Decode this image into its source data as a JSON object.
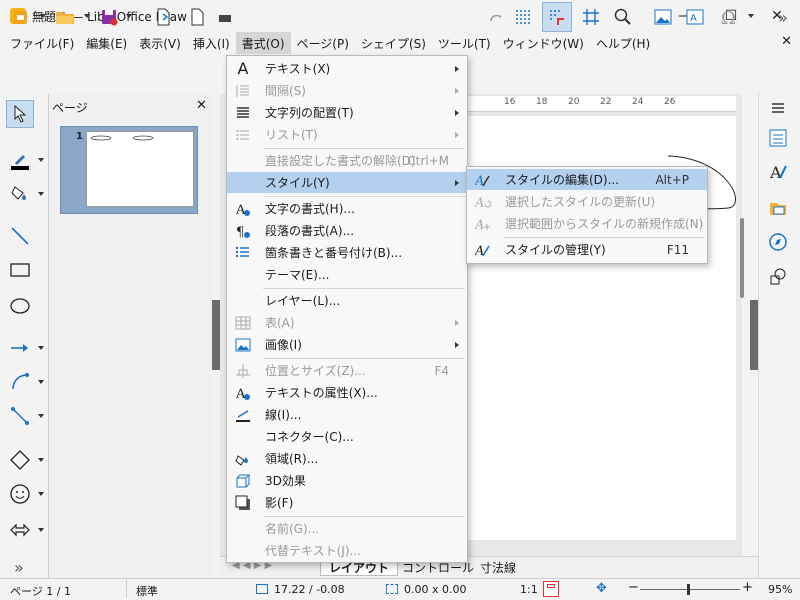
{
  "window": {
    "title": "無題 1 — LibreOffice Draw",
    "minimize": "—",
    "maximize": "☐",
    "close": "✕"
  },
  "menubar": {
    "items": [
      "ファイル(F)",
      "編集(E)",
      "表示(V)",
      "挿入(I)",
      "書式(O)",
      "ページ(P)",
      "シェイプ(S)",
      "ツール(T)",
      "ウィンドウ(W)",
      "ヘルプ(H)"
    ],
    "close": "✕"
  },
  "pages_panel": {
    "title": "ページ",
    "close": "✕",
    "page_number": "1"
  },
  "ruler": {
    "ticks": [
      "16",
      "18",
      "20",
      "22",
      "24",
      "26"
    ]
  },
  "tabs": {
    "layout": "レイアウト",
    "controls": "コントロール",
    "dimension": "寸法線"
  },
  "status": {
    "page": "ページ 1 / 1",
    "style": "標準",
    "position": "17.22 / -0.08",
    "size": "0.00 x 0.00",
    "scale": "1:1",
    "zoom": "95%",
    "zoom_minus": "−",
    "zoom_plus": "+"
  },
  "format_menu": {
    "text": "テキスト(X)",
    "spacing": "間隔(S)",
    "align_text": "文字列の配置(T)",
    "lists": "リスト(T)",
    "clear_direct": "直接設定した書式の解除(D)",
    "clear_direct_shortcut": "Ctrl+M",
    "styles": "スタイル(Y)",
    "character": "文字の書式(H)...",
    "paragraph": "段落の書式(A)...",
    "bullets": "箇条書きと番号付け(B)...",
    "theme": "テーマ(E)...",
    "layer": "レイヤー(L)...",
    "table": "表(A)",
    "image": "画像(I)",
    "position_size": "位置とサイズ(Z)...",
    "position_size_shortcut": "F4",
    "text_attributes": "テキストの属性(X)...",
    "line": "線(I)...",
    "connector": "コネクター(C)...",
    "area": "領域(R)...",
    "effects_3d": "3D効果",
    "shadow": "影(F)",
    "name": "名前(G)...",
    "alt_text": "代替テキスト(J)..."
  },
  "styles_submenu": {
    "edit_style": "スタイルの編集(D)...",
    "edit_style_shortcut": "Alt+P",
    "update_style": "選択したスタイルの更新(U)",
    "new_style": "選択範囲からスタイルの新規作成(N)",
    "manage_styles": "スタイルの管理(Y)",
    "manage_styles_shortcut": "F11"
  },
  "colors": {
    "accent": "#b4d0ef",
    "highlight_border": "#8db2d9",
    "app_icon": "#f5b315",
    "pages_panel": "#8aa7c8"
  }
}
